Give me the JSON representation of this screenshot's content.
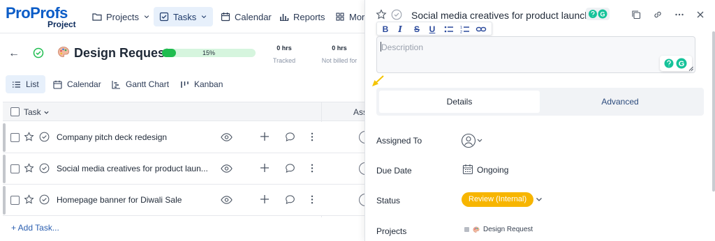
{
  "brand": {
    "name": "ProProfs",
    "product": "Project"
  },
  "nav": {
    "items": [
      {
        "label": "Projects"
      },
      {
        "label": "Tasks"
      },
      {
        "label": "Calendar"
      },
      {
        "label": "Reports"
      },
      {
        "label": "More"
      }
    ]
  },
  "project": {
    "title": "Design Request",
    "progress_label": "15%",
    "progress_value": 0.15,
    "tracked_value": "0 hrs",
    "tracked_label": "Tracked",
    "nbf_value": "0 hrs",
    "nbf_label": "Not billed for"
  },
  "views": [
    {
      "label": "List"
    },
    {
      "label": "Calendar"
    },
    {
      "label": "Gantt Chart"
    },
    {
      "label": "Kanban"
    }
  ],
  "table": {
    "col_task": "Task",
    "col_assignee": "Ass",
    "rows": [
      {
        "name": "Company pitch deck redesign"
      },
      {
        "name": "Social media creatives for product laun..."
      },
      {
        "name": "Homepage banner for Diwali Sale"
      }
    ],
    "add_task": "+ Add Task..."
  },
  "panel": {
    "title": "Social media creatives for product launch",
    "toolbar": {
      "bold": "B",
      "italic": "I",
      "strike": "S",
      "underline": "U"
    },
    "description_placeholder": "Description",
    "tabs": [
      {
        "label": "Details"
      },
      {
        "label": "Advanced"
      }
    ],
    "fields": {
      "assigned_to_label": "Assigned To",
      "due_date_label": "Due Date",
      "due_date_value": "Ongoing",
      "status_label": "Status",
      "status_value": "Review (Internal)",
      "projects_label": "Projects",
      "projects_value": "Design Request"
    }
  },
  "colors": {
    "brand_blue": "#0b5cc7",
    "progress_green": "#1fbd4f",
    "status_yellow": "#f7b500",
    "grammarly_green": "#15c39a"
  }
}
